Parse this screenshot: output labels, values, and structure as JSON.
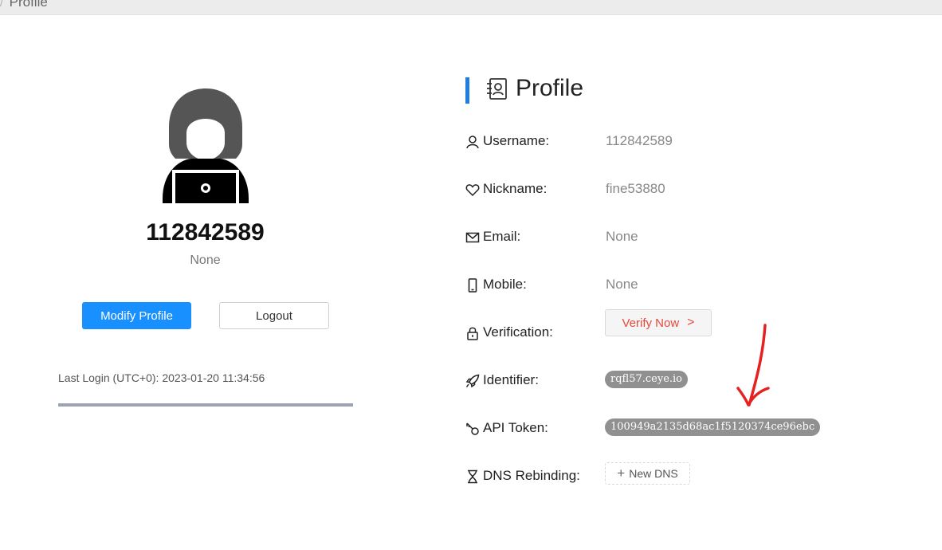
{
  "breadcrumb": {
    "separator": "/",
    "current": "Profile"
  },
  "user_card": {
    "username": "112842589",
    "subtitle": "None",
    "modify_button": "Modify Profile",
    "logout_button": "Logout",
    "last_login": "Last Login (UTC+0): 2023-01-20 11:34:56",
    "progress_fraction": 1.0
  },
  "profile": {
    "title": "Profile",
    "rows": {
      "username": {
        "label": "Username:",
        "value": "112842589",
        "icon": "user-icon"
      },
      "nickname": {
        "label": "Nickname:",
        "value": "fine53880",
        "icon": "heart-icon"
      },
      "email": {
        "label": "Email:",
        "value": "None",
        "icon": "mail-icon"
      },
      "mobile": {
        "label": "Mobile:",
        "value": "None",
        "icon": "mobile-icon"
      },
      "verification": {
        "label": "Verification:",
        "button": "Verify Now",
        "chevron": ">",
        "icon": "lock-icon"
      },
      "identifier": {
        "label": "Identifier:",
        "value": "rqfl57.ceye.io",
        "icon": "rocket-icon"
      },
      "api_token": {
        "label": "API Token:",
        "value": "100949a2135d68ac1f5120374ce96ebc",
        "icon": "key-icon"
      },
      "dns_rebinding": {
        "label": "DNS Rebinding:",
        "button": "New DNS",
        "plus": "+",
        "icon": "hourglass-icon"
      }
    }
  },
  "colors": {
    "accent": "#1890ff",
    "section_bar": "#1e7fe0",
    "verify_text": "#e64a3c",
    "tag_bg": "#909090",
    "annotation": "#e52222"
  }
}
